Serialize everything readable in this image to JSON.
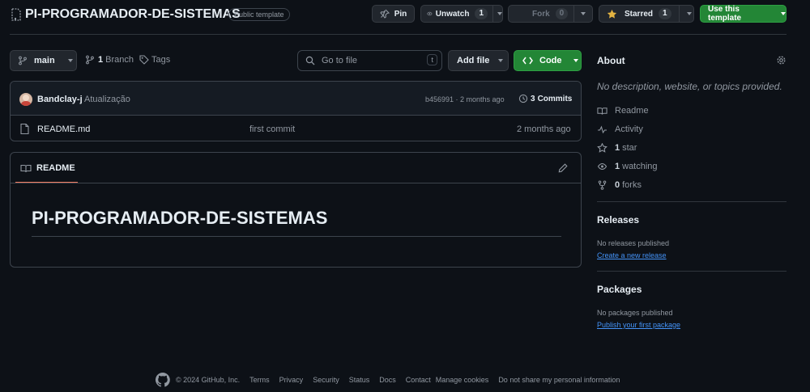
{
  "repo": {
    "name": "PI-PROGRAMADOR-DE-SISTEMAS",
    "visibility_badge": "Public template"
  },
  "header_actions": {
    "pin_label": "Pin",
    "unwatch_label": "Unwatch",
    "unwatch_count": "1",
    "fork_label": "Fork",
    "fork_count": "0",
    "starred_label": "Starred",
    "starred_count": "1",
    "use_template_label": "Use this template"
  },
  "toolbar": {
    "branch": "main",
    "branch_count": "1",
    "branch_label": "Branch",
    "tags_label": "Tags",
    "go_to_file_placeholder": "Go to file",
    "go_to_file_shortcut": "t",
    "add_file_label": "Add file",
    "code_label": "Code"
  },
  "latest_commit": {
    "author": "Bandclay-j",
    "message": "Atualização",
    "hash_time": "b456991 · 2 months ago",
    "commits_count": "3",
    "commits_label": "Commits"
  },
  "files": [
    {
      "name": "README.md",
      "commit_message": "first commit",
      "time": "2 months ago"
    }
  ],
  "readme": {
    "tab_label": "README",
    "heading": "PI-PROGRAMADOR-DE-SISTEMAS"
  },
  "about": {
    "title": "About",
    "description": "No description, website, or topics provided.",
    "readme_label": "Readme",
    "activity_label": "Activity",
    "stars_count": "1",
    "stars_label": "star",
    "watching_count": "1",
    "watching_label": "watching",
    "forks_count": "0",
    "forks_label": "forks"
  },
  "releases": {
    "title": "Releases",
    "empty_text": "No releases published",
    "create_link": "Create a new release"
  },
  "packages": {
    "title": "Packages",
    "empty_text": "No packages published",
    "publish_link": "Publish your first package"
  },
  "footer": {
    "copyright": "© 2024 GitHub, Inc.",
    "links": [
      "Terms",
      "Privacy",
      "Security",
      "Status",
      "Docs",
      "Contact",
      "Manage cookies",
      "Do not share my personal information"
    ]
  },
  "colors": {
    "background": "#0d1117",
    "accent_green": "#238636",
    "link_blue": "#4493f8",
    "star_yellow": "#e3b341",
    "tab_underline": "#f78166"
  }
}
